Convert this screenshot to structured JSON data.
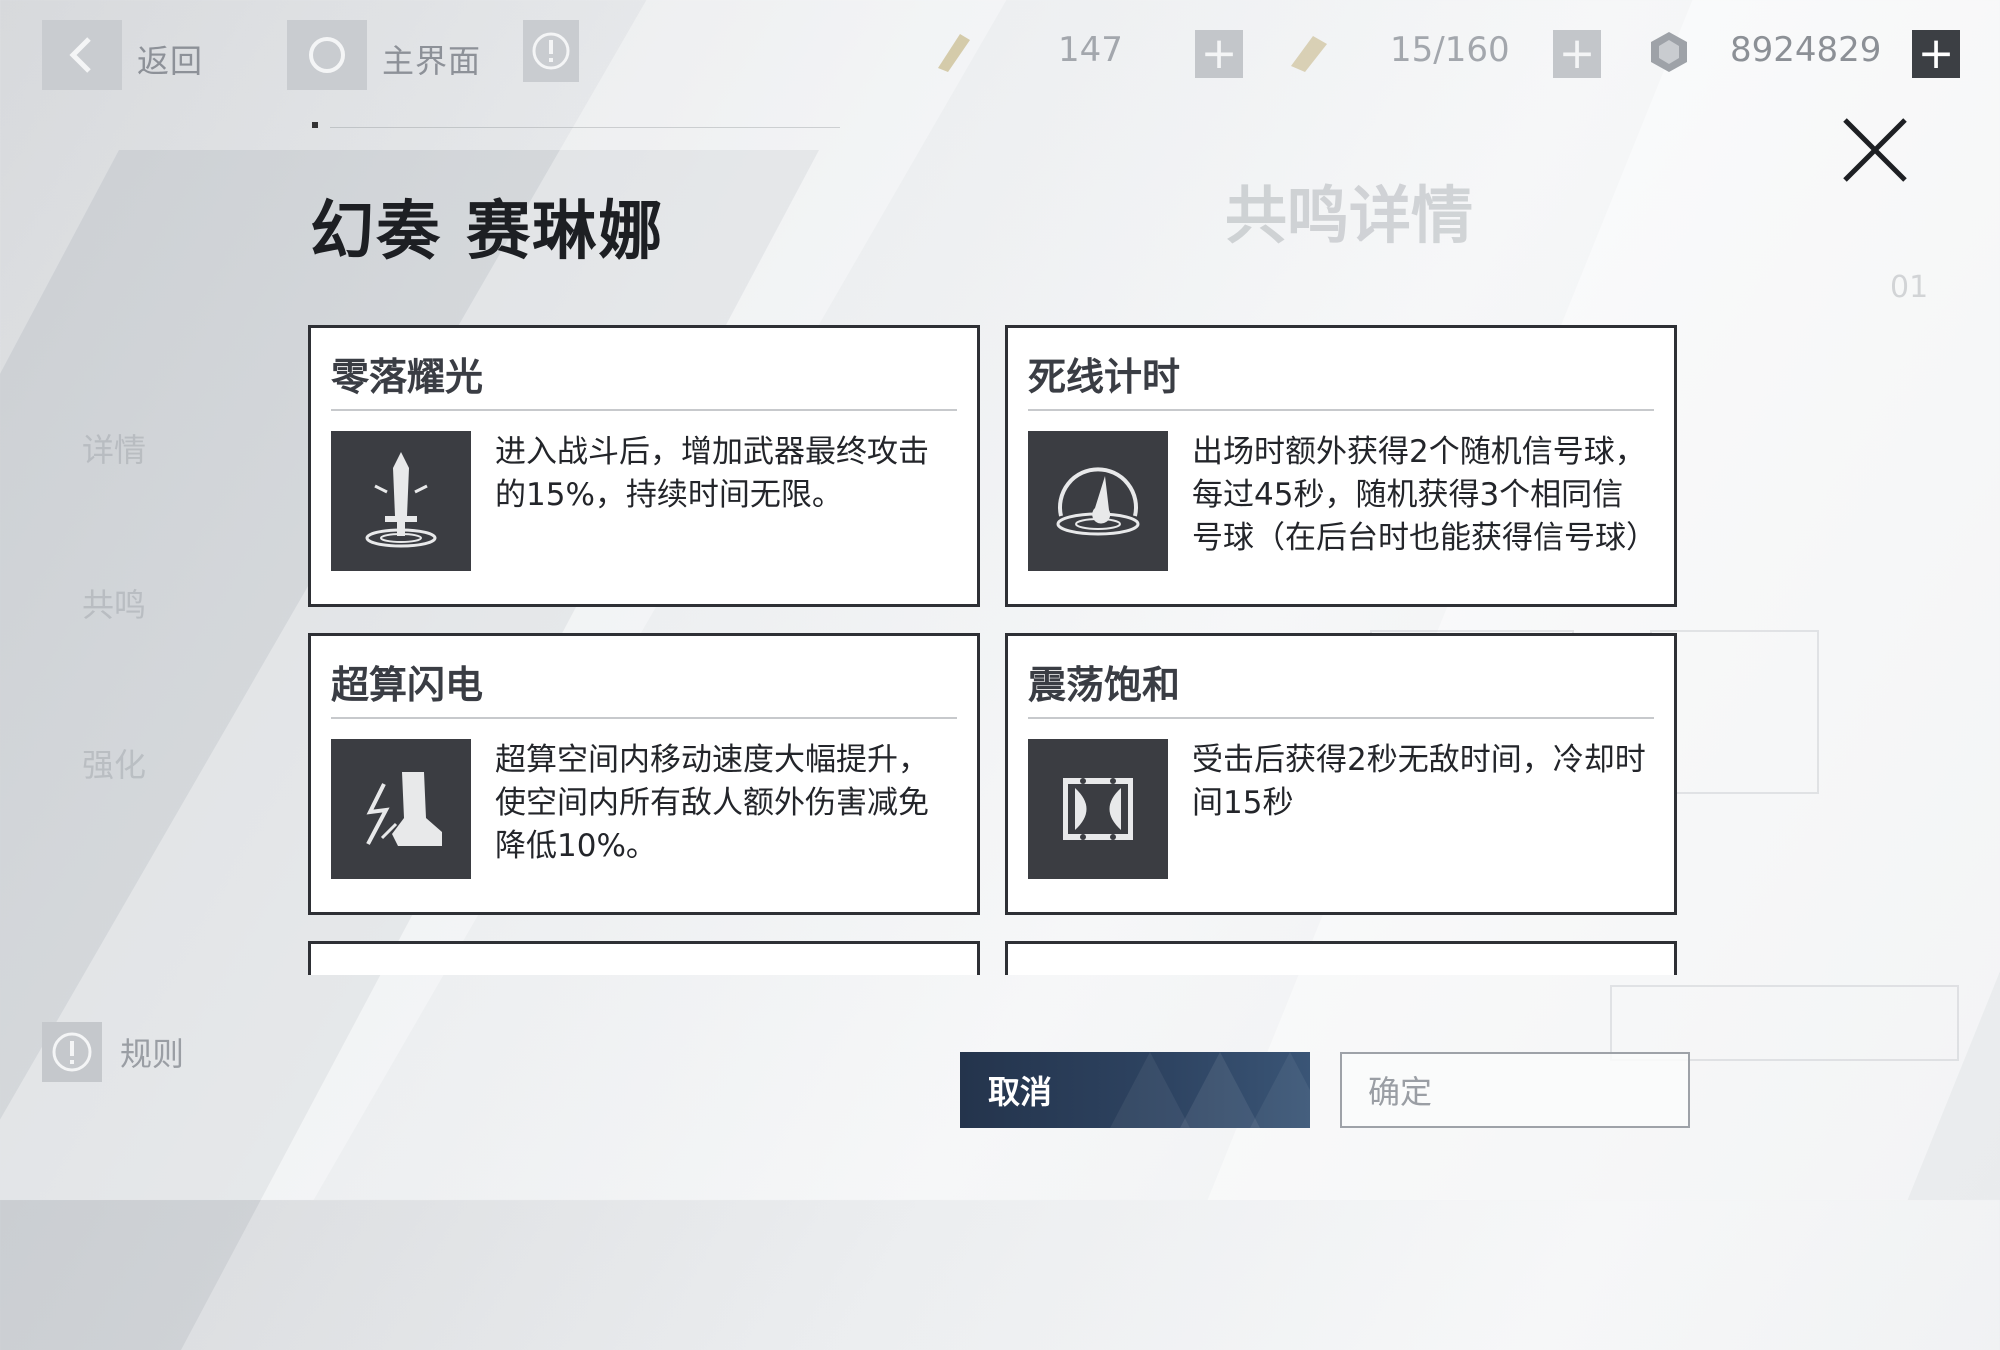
{
  "topbar": {
    "back_label": "返回",
    "home_label": "主界面",
    "resources": [
      {
        "icon": "stamina-icon",
        "value": "147"
      },
      {
        "icon": "ticket-icon",
        "value": "15/160"
      },
      {
        "icon": "coin-icon",
        "value": "8924829"
      }
    ]
  },
  "background": {
    "title": "共鸣详情",
    "number": "01",
    "side_items": [
      "详情",
      "共鸣",
      "强化"
    ],
    "rules_label": "规则"
  },
  "dialog": {
    "title": "幻奏 赛琳娜",
    "cards": [
      {
        "title": "零落耀光",
        "icon": "sword-light-icon",
        "desc": "进入战斗后，增加武器最终攻击的15%，持续时间无限。"
      },
      {
        "title": "死线计时",
        "icon": "signal-orb-icon",
        "desc": "出场时额外获得2个随机信号球，每过45秒，随机获得3个相同信号球（在后台时也能获得信号球）"
      },
      {
        "title": "超算闪电",
        "icon": "lightning-boot-icon",
        "desc": "超算空间内移动速度大幅提升，使空间内所有敌人额外伤害减免降低10%。"
      },
      {
        "title": "震荡饱和",
        "icon": "hourglass-shield-icon",
        "desc": "受击后获得2秒无敌时间，冷却时间15秒"
      }
    ],
    "cancel_label": "取消",
    "confirm_label": "确定"
  },
  "colors": {
    "card_border": "#2e3035",
    "icon_bg": "#3b3d42",
    "cancel_bg": "#2e4462"
  }
}
